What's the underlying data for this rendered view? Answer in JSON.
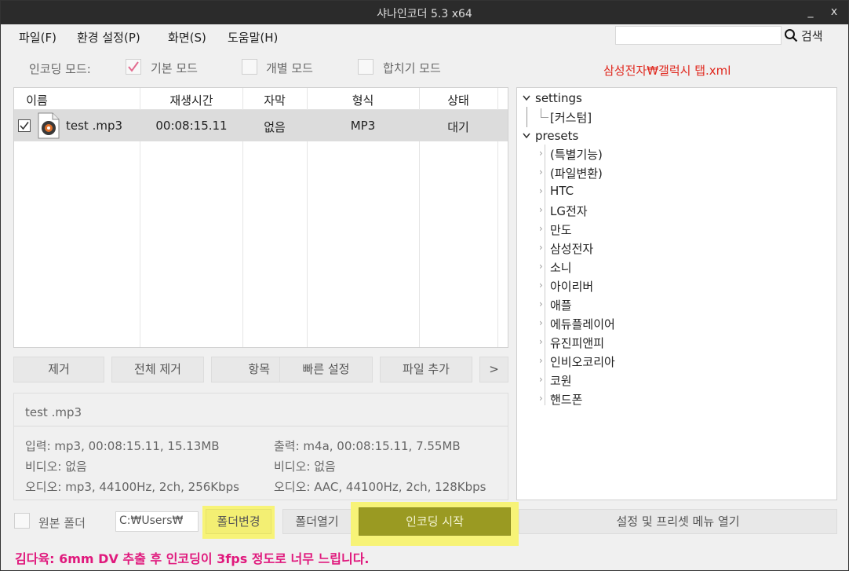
{
  "window": {
    "title": "샤나인코더  5.3  x64",
    "minimize": "_",
    "close": "x"
  },
  "menu": {
    "items": [
      "파일(F)",
      "환경 설정(P)",
      "화면(S)",
      "도움말(H)"
    ],
    "search_label": "검색",
    "search_value": ""
  },
  "modes": {
    "label": "인코딩 모드:",
    "options": [
      {
        "label": "기본 모드",
        "checked": true
      },
      {
        "label": "개별 모드",
        "checked": false
      },
      {
        "label": "합치기 모드",
        "checked": false
      }
    ]
  },
  "preset_path": "삼성전자₩갤럭시 탭.xml",
  "file_list": {
    "columns": [
      "이름",
      "재생시간",
      "자막",
      "형식",
      "상태"
    ],
    "rows": [
      {
        "checked": true,
        "name": "test .mp3",
        "duration": "00:08:15.11",
        "subtitle": "없음",
        "format": "MP3",
        "status": "대기"
      }
    ]
  },
  "list_buttons": {
    "remove": "제거",
    "remove_all": "전체 제거",
    "items": "항목",
    "quick_settings": "빠른 설정",
    "add_file": "파일 추가",
    "more": ">"
  },
  "info": {
    "file": "test .mp3",
    "input": "입력: mp3, 00:08:15.11, 15.13MB",
    "input_video": "비디오: 없음",
    "input_audio": "오디오: mp3, 44100Hz, 2ch, 256Kbps",
    "output": "출력: m4a, 00:08:15.11, 7.55MB",
    "output_video": "비디오: 없음",
    "output_audio": "오디오: AAC, 44100Hz, 2ch, 128Kbps"
  },
  "tree": {
    "settings": {
      "label": "settings",
      "children": [
        "[커스텀]"
      ]
    },
    "presets": {
      "label": "presets",
      "children": [
        "(특별기능)",
        "(파일변환)",
        "HTC",
        "LG전자",
        "만도",
        "삼성전자",
        "소니",
        "아이리버",
        "애플",
        "에듀플레이어",
        "유진피앤피",
        "인비오코리아",
        "코원",
        "핸드폰"
      ]
    }
  },
  "bottom": {
    "source_folder_label": "원본 폴더",
    "output_path": "C:₩Users₩",
    "change_folder": "폴더변경",
    "open_folder": "폴더열기",
    "start_encoding": "인코딩 시작",
    "open_settings_menu": "설정 및 프리셋 메뉴 열기"
  },
  "status_message": "김다육: 6mm DV 추출 후 인코딩이 3fps 정도로 너무 느립니다.",
  "colors": {
    "titlebar": "#2b2b2b",
    "highlight": "#f7f377",
    "start_button": "#9a9a22",
    "preset_path": "#e0281e",
    "status": "#e0197d"
  }
}
